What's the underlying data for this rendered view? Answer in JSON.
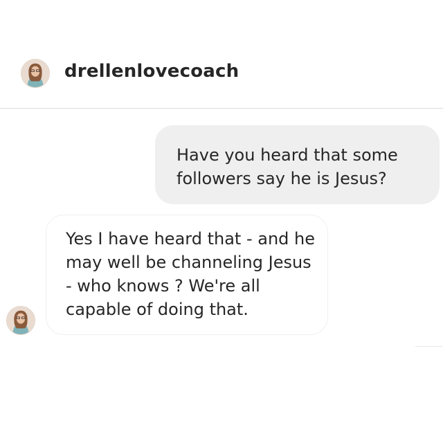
{
  "thread": {
    "username": "drellenlovecoach",
    "avatar_icon": "profile-photo-avatar-icon"
  },
  "messages": [
    {
      "direction": "outgoing",
      "text": "Have you heard that some followers say he is Jesus?"
    },
    {
      "direction": "incoming",
      "text": "Yes I have heard that - and he may well be channeling Jesus - who knows ? We're all capable of doing that."
    }
  ],
  "colors": {
    "outgoing_bubble": "#efefef",
    "incoming_border": "#efefef",
    "text": "#262626",
    "divider": "#dbdbdb"
  }
}
